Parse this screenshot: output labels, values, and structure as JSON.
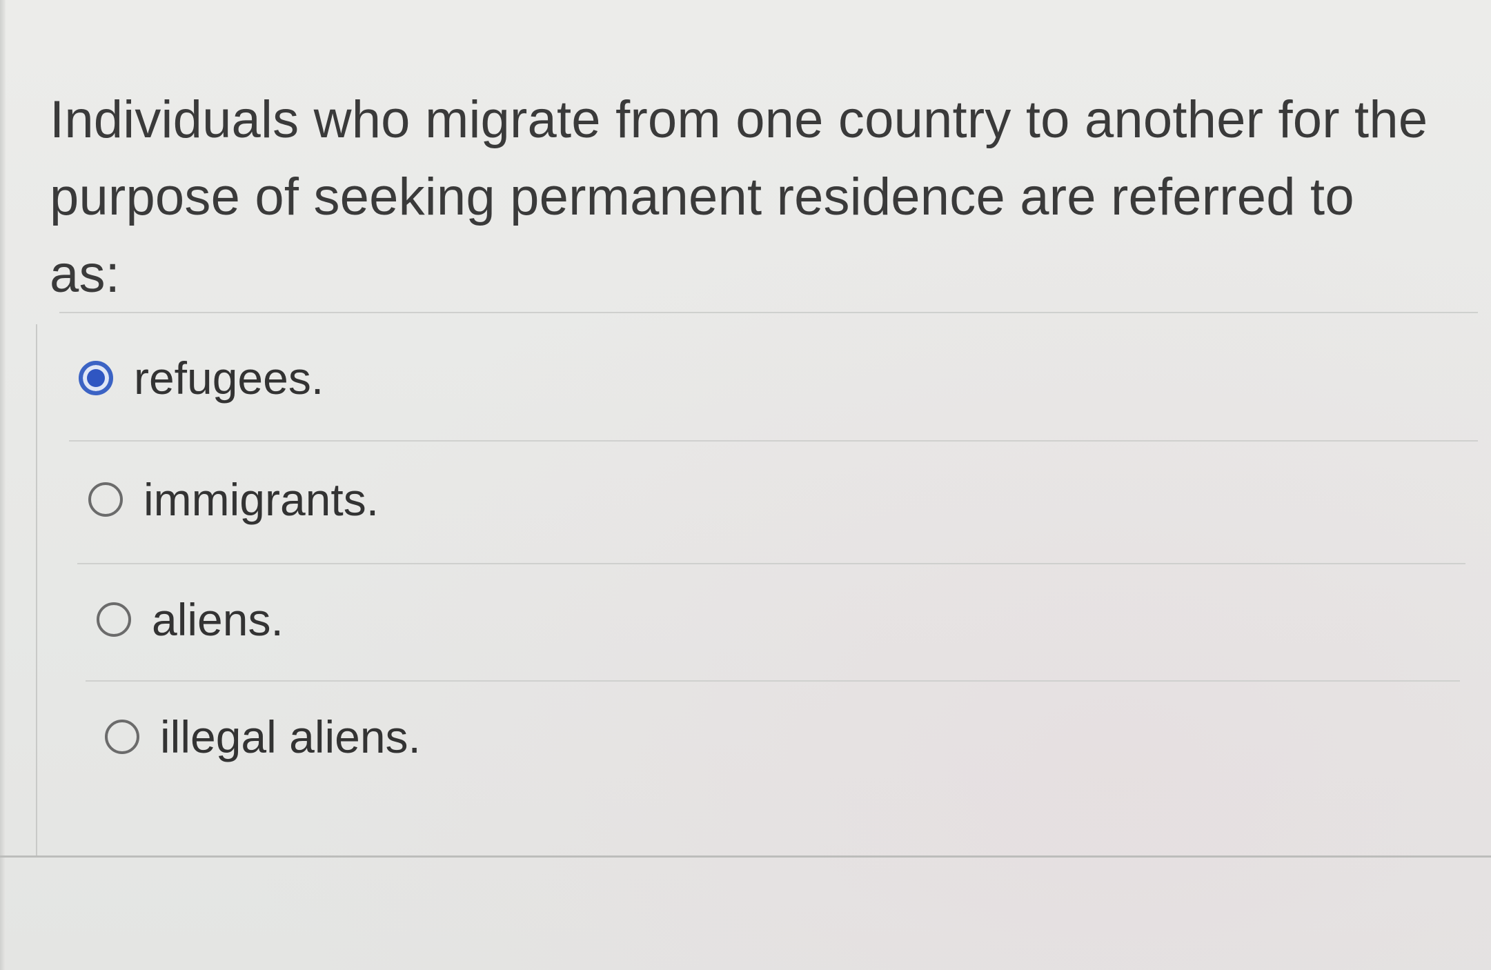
{
  "question": {
    "line1": "Individuals who migrate from one country to another for the",
    "line2": "purpose of seeking permanent residence are referred to as:"
  },
  "options": [
    {
      "label": "refugees.",
      "selected": true
    },
    {
      "label": "immigrants.",
      "selected": false
    },
    {
      "label": "aliens.",
      "selected": false
    },
    {
      "label": "illegal aliens.",
      "selected": false
    }
  ],
  "colors": {
    "selected_radio": "#2f56c2",
    "text": "#333333",
    "background": "#e9e9e7"
  }
}
